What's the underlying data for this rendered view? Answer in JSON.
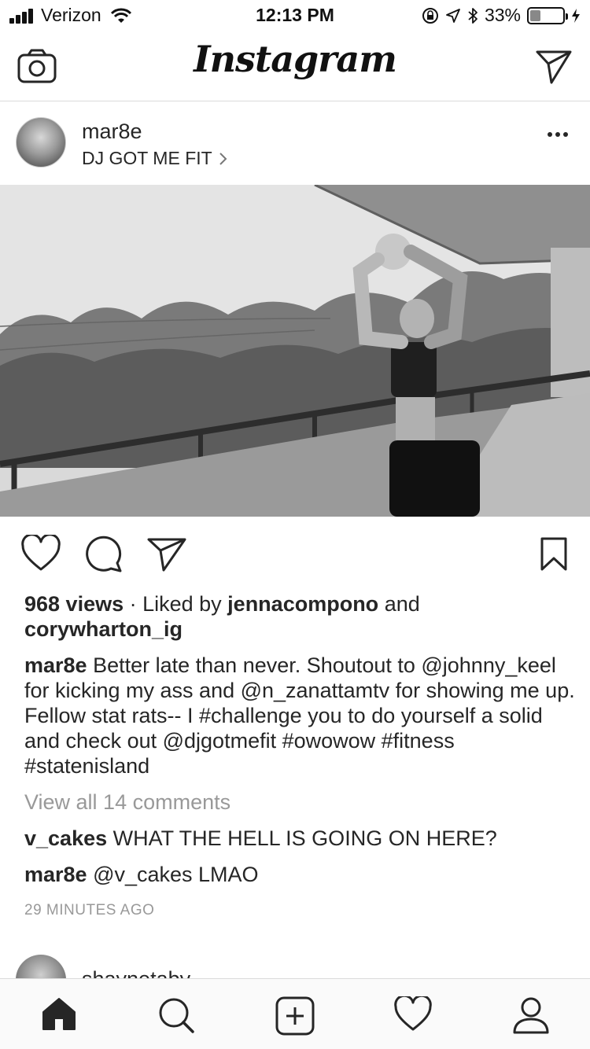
{
  "status_bar": {
    "carrier": "Verizon",
    "time": "12:13 PM",
    "battery": "33%",
    "battery_level": 0.33
  },
  "nav": {
    "logo": "Instagram",
    "camera_icon": "camera-icon",
    "direct_icon": "direct-send-icon"
  },
  "post": {
    "username": "mar8e",
    "location": "DJ GOT ME FIT",
    "views": "968 views",
    "liked_sep": " · Liked by ",
    "liker1": "jennacompono",
    "and": " and",
    "liker2": "corywharton_ig",
    "caption_user": "mar8e",
    "caption_text": " Better late than never. Shoutout to @johnny_keel for kicking my ass and @n_zanattamtv for showing me up. Fellow stat rats-- I #challenge you to do yourself a solid and check out @djgotmefit #owowow #fitness #statenisland",
    "view_all": "View all 14 comments",
    "comments": [
      {
        "user": "v_cakes",
        "text": " WHAT THE HELL IS GOING ON HERE?"
      },
      {
        "user": "mar8e",
        "text": " @v_cakes LMAO"
      }
    ],
    "timestamp": "29 MINUTES AGO"
  },
  "next_post": {
    "username": "shaynetaby"
  },
  "tabbar": {
    "items": [
      "home-icon",
      "search-icon",
      "add-post-icon",
      "activity-heart-icon",
      "profile-icon"
    ]
  }
}
